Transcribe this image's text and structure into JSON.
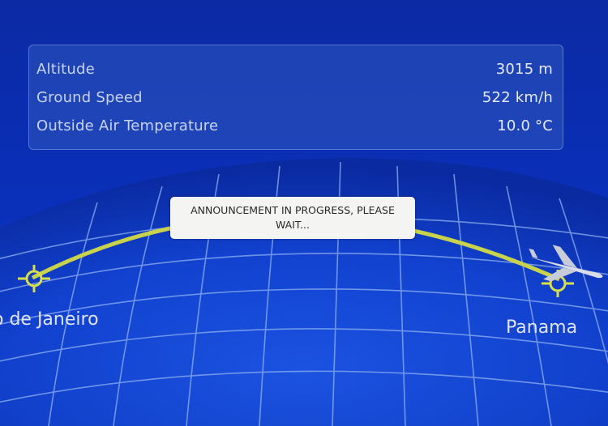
{
  "flight_info": {
    "altitude": {
      "label": "Altitude",
      "value": "3015 m"
    },
    "ground_speed": {
      "label": "Ground Speed",
      "value": "522 km/h"
    },
    "outside_air_temperature": {
      "label": "Outside Air Temperature",
      "value": "10.0 °C"
    }
  },
  "announcement": {
    "text": "ANNOUNCEMENT IN PROGRESS, PLEASE WAIT..."
  },
  "map": {
    "origin_label": "o de Janeiro",
    "destination_label": "Panama",
    "route_color": "#c8d24a",
    "grid_color": "#8fb0f0",
    "icons": [
      "airport-marker-icon",
      "aircraft-icon"
    ]
  }
}
